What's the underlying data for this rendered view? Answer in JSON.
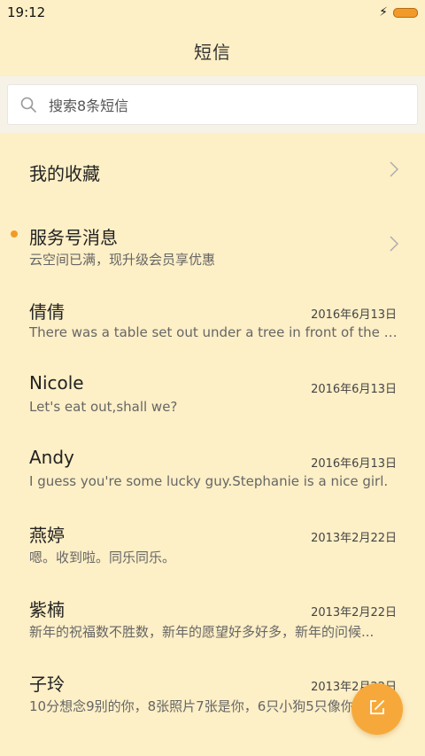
{
  "status": {
    "time": "19:12"
  },
  "header": {
    "title": "短信"
  },
  "search": {
    "placeholder": "搜索8条短信"
  },
  "favorites": {
    "label": "我的收藏"
  },
  "service": {
    "title": "服务号消息",
    "preview": "云空间已满，现升级会员享优惠"
  },
  "messages": [
    {
      "name": "倩倩",
      "date": "2016年6月13日",
      "preview": "There was a table set out under a tree in front of the ho..."
    },
    {
      "name": "Nicole",
      "date": "2016年6月13日",
      "preview": "Let's eat out,shall we?"
    },
    {
      "name": "Andy",
      "date": "2016年6月13日",
      "preview": "I guess you're some lucky guy.Stephanie is a nice girl."
    },
    {
      "name": "燕婷",
      "date": "2013年2月22日",
      "preview": "嗯。收到啦。同乐同乐。"
    },
    {
      "name": "紫楠",
      "date": "2013年2月22日",
      "preview": "新年的祝福数不胜数，新年的愿望好多好多，新年的问候..."
    },
    {
      "name": "子玲",
      "date": "2013年2月22日",
      "preview": "10分想念9别的你，8张照片7张是你，6只小狗5只像你"
    }
  ],
  "icons": {
    "search": "search-icon",
    "chevron": "chevron-right-icon",
    "compose": "compose-icon",
    "charging": "charging-bolt-icon",
    "battery": "battery-icon"
  },
  "colors": {
    "background": "#fdefc6",
    "accent": "#f6a93a",
    "unread_dot": "#f29a26"
  }
}
